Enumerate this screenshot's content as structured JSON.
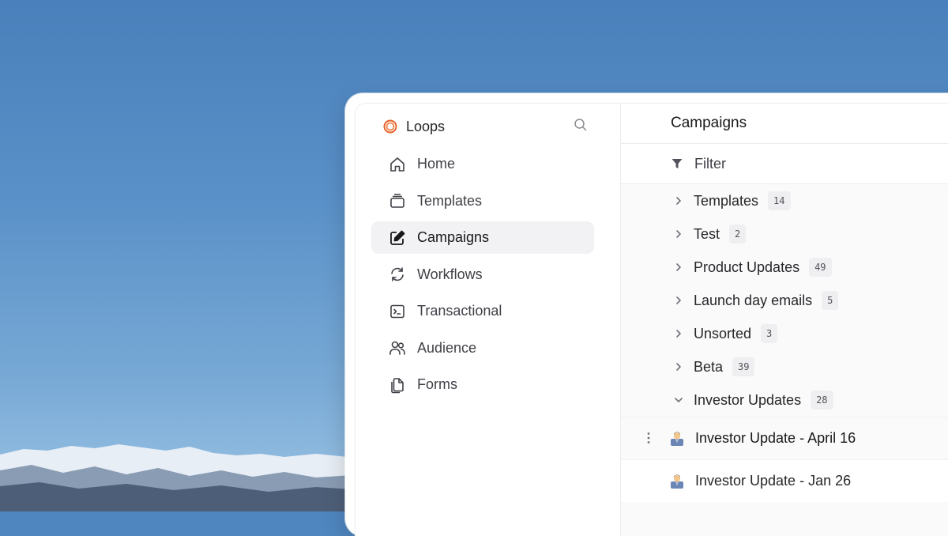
{
  "app": {
    "name": "Loops",
    "accent": "#e8622c"
  },
  "sidebar": {
    "items": [
      {
        "label": "Home",
        "icon": "home-icon",
        "active": false
      },
      {
        "label": "Templates",
        "icon": "templates-icon",
        "active": false
      },
      {
        "label": "Campaigns",
        "icon": "edit-icon",
        "active": true
      },
      {
        "label": "Workflows",
        "icon": "refresh-icon",
        "active": false
      },
      {
        "label": "Transactional",
        "icon": "terminal-icon",
        "active": false
      },
      {
        "label": "Audience",
        "icon": "users-icon",
        "active": false
      },
      {
        "label": "Forms",
        "icon": "files-icon",
        "active": false
      }
    ]
  },
  "main": {
    "title": "Campaigns",
    "filter_label": "Filter",
    "folders": [
      {
        "name": "Templates",
        "count": "14",
        "expanded": false
      },
      {
        "name": "Test",
        "count": "2",
        "expanded": false
      },
      {
        "name": "Product Updates",
        "count": "49",
        "expanded": false
      },
      {
        "name": "Launch day emails",
        "count": "5",
        "expanded": false
      },
      {
        "name": "Unsorted",
        "count": "3",
        "expanded": false
      },
      {
        "name": "Beta",
        "count": "39",
        "expanded": false
      },
      {
        "name": "Investor Updates",
        "count": "28",
        "expanded": true
      }
    ],
    "campaigns": [
      {
        "name": "Investor Update - April 16",
        "icon": "person-emoji-icon"
      },
      {
        "name": "Investor Update - Jan 26",
        "icon": "person-emoji-icon"
      }
    ]
  }
}
